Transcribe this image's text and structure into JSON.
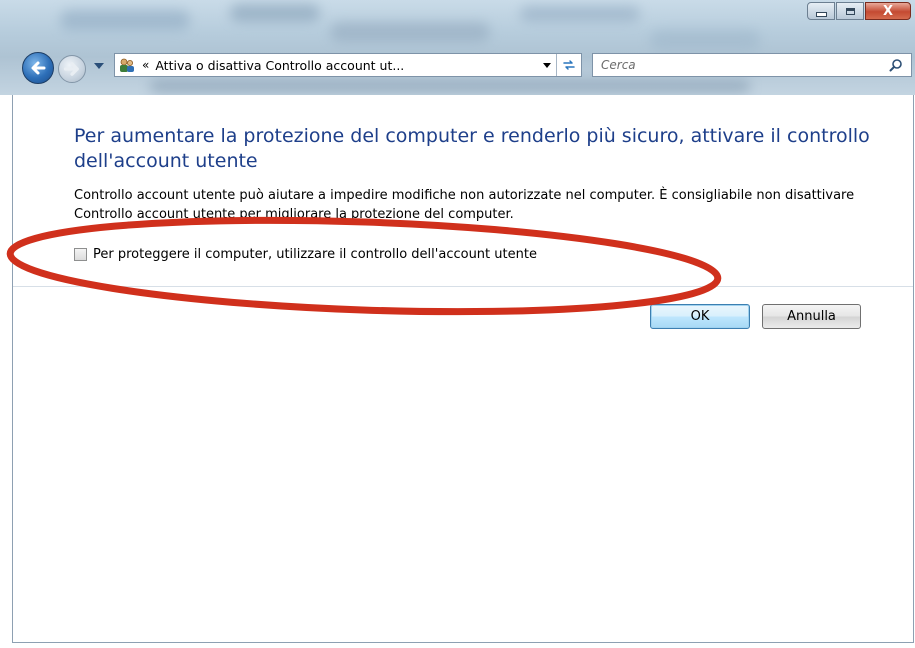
{
  "window": {
    "controls": {
      "minimize": "minimize",
      "maximize": "maximize",
      "close": "X"
    }
  },
  "nav": {
    "breadcrumb_separator": "«",
    "address": "Attiva o disattiva Controllo account ut...",
    "search_placeholder": "Cerca"
  },
  "main": {
    "heading": "Per aumentare la protezione del computer e renderlo più sicuro, attivare il controllo dell'account utente",
    "description": "Controllo account utente può aiutare a impedire modifiche non autorizzate nel computer. È consigliabile non disattivare Controllo account utente per migliorare la protezione del computer.",
    "checkbox_label": "Per proteggere il computer, utilizzare il controllo dell'account utente",
    "checkbox_checked": false
  },
  "buttons": {
    "ok": "OK",
    "cancel": "Annulla"
  },
  "annotation": {
    "shape": "ellipse",
    "color": "#d0301c"
  },
  "colors": {
    "heading": "#1e3f8a",
    "titlebar": "#b6ccdc",
    "ok_button": "#bee6fd"
  },
  "icons": [
    "back-arrow-icon",
    "forward-arrow-icon",
    "users-control-panel-icon",
    "refresh-icon",
    "search-icon"
  ]
}
